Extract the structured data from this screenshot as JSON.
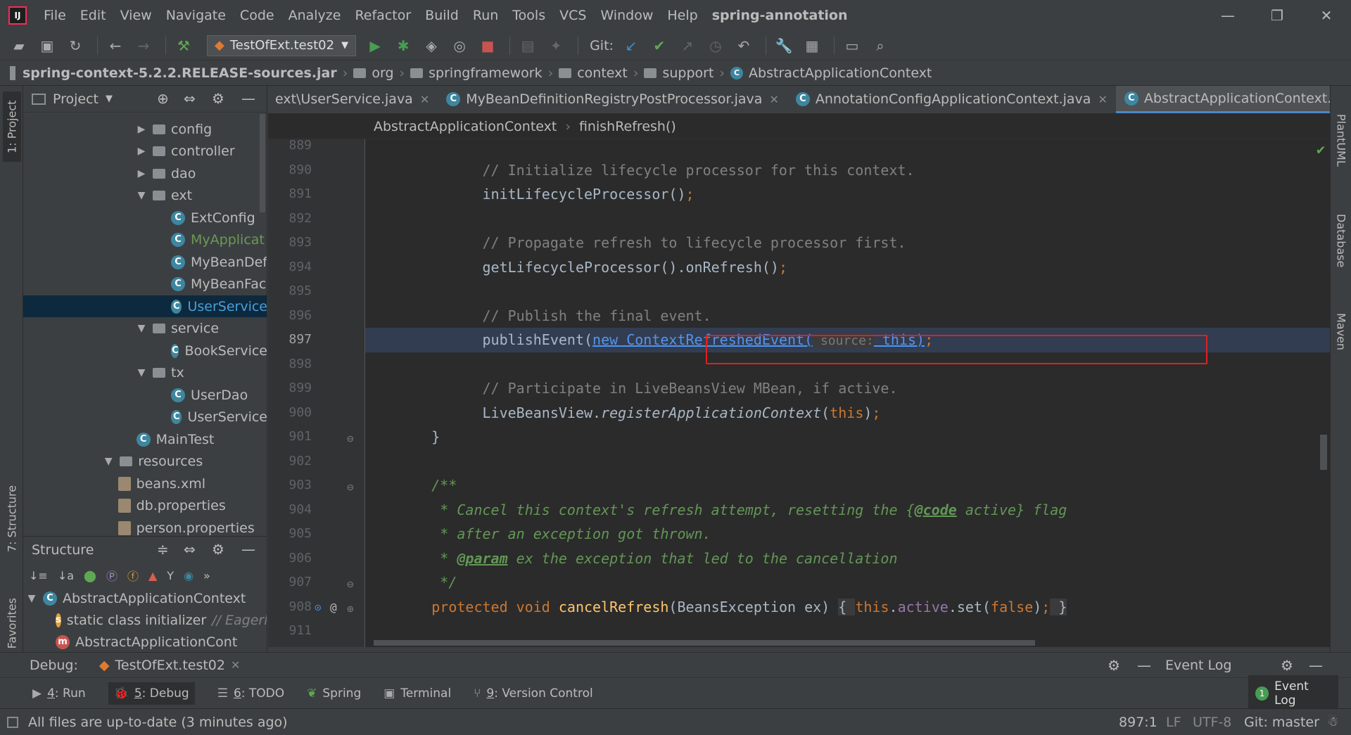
{
  "menu": {
    "items": [
      "File",
      "Edit",
      "View",
      "Navigate",
      "Code",
      "Analyze",
      "Refactor",
      "Build",
      "Run",
      "Tools",
      "VCS",
      "Window",
      "Help"
    ],
    "project_title": "spring-annotation"
  },
  "toolbar": {
    "run_config": "TestOfExt.test02",
    "git_label": "Git:"
  },
  "navbar": {
    "crumbs": [
      "spring-context-5.2.2.RELEASE-sources.jar",
      "org",
      "springframework",
      "context",
      "support",
      "AbstractApplicationContext"
    ]
  },
  "left_strip": {
    "project_tab": "1: Project",
    "structure_tab": "7: Structure",
    "favorites_tab": "2: Favorites"
  },
  "right_strip": {
    "plantuml": "PlantUML",
    "database": "Database",
    "maven": "Maven"
  },
  "project_panel": {
    "title": "Project",
    "tree": [
      {
        "label": "config",
        "type": "folder",
        "expanded": false
      },
      {
        "label": "controller",
        "type": "folder",
        "expanded": false
      },
      {
        "label": "dao",
        "type": "folder",
        "expanded": false
      },
      {
        "label": "ext",
        "type": "folder",
        "expanded": true
      },
      {
        "label": "ExtConfig",
        "type": "class"
      },
      {
        "label": "MyApplicat",
        "type": "class"
      },
      {
        "label": "MyBeanDef",
        "type": "class"
      },
      {
        "label": "MyBeanFac",
        "type": "class"
      },
      {
        "label": "UserService",
        "type": "class",
        "selected": true
      },
      {
        "label": "service",
        "type": "folder",
        "expanded": true
      },
      {
        "label": "BookService",
        "type": "class"
      },
      {
        "label": "tx",
        "type": "folder",
        "expanded": true
      },
      {
        "label": "UserDao",
        "type": "class"
      },
      {
        "label": "UserService",
        "type": "class"
      },
      {
        "label": "MainTest",
        "type": "class"
      },
      {
        "label": "resources",
        "type": "folder",
        "expanded": true
      },
      {
        "label": "beans.xml",
        "type": "file"
      },
      {
        "label": "db.properties",
        "type": "file"
      },
      {
        "label": "person.properties",
        "type": "file"
      }
    ]
  },
  "structure_panel": {
    "title": "Structure",
    "items": [
      {
        "label": "AbstractApplicationContext",
        "suffix": ""
      },
      {
        "label": "static class initializer",
        "suffix": "// Eagerly"
      },
      {
        "label": "AbstractApplicationCont",
        "suffix": ""
      }
    ]
  },
  "editor": {
    "tabs": [
      {
        "label": "ext\\UserService.java",
        "active": false
      },
      {
        "label": "MyBeanDefinitionRegistryPostProcessor.java",
        "active": false
      },
      {
        "label": "AnnotationConfigApplicationContext.java",
        "active": false
      },
      {
        "label": "AbstractApplicationContext.java",
        "active": true
      }
    ],
    "tab_overflow": "6",
    "breadcrumb": [
      "AbstractApplicationContext",
      "finishRefresh()"
    ],
    "current_line": 897,
    "lines": [
      {
        "n": "889"
      },
      {
        "n": "890",
        "comment": "// Initialize lifecycle processor for this context."
      },
      {
        "n": "891",
        "call": "initLifecycleProcessor",
        "rest": "();"
      },
      {
        "n": "892"
      },
      {
        "n": "893",
        "comment": "// Propagate refresh to lifecycle processor first."
      },
      {
        "n": "894",
        "call": "getLifecycleProcessor().onRefresh",
        "rest": "();"
      },
      {
        "n": "895"
      },
      {
        "n": "896",
        "comment": "// Publish the final event."
      },
      {
        "n": "897",
        "call": "publishEvent(",
        "new_kw": "new ",
        "type": "ContextRefreshedEvent(",
        "hint": " source:",
        "this_kw": " this",
        "end": ");"
      },
      {
        "n": "898"
      },
      {
        "n": "899",
        "comment": "// Participate in LiveBeansView MBean, if active."
      },
      {
        "n": "900",
        "cls": "LiveBeansView.",
        "method": "registerApplicationContext",
        "open": "(",
        "this_kw": "this",
        "end": ");"
      },
      {
        "n": "901",
        "brace": "}"
      },
      {
        "n": "902"
      },
      {
        "n": "903",
        "doc": "/**"
      },
      {
        "n": "904",
        "doc_pre": " * Cancel this context's refresh attempt, resetting the {",
        "doc_tag": "@code",
        "doc_post": " active} flag"
      },
      {
        "n": "905",
        "doc": " * after an exception got thrown."
      },
      {
        "n": "906",
        "doc_pre": " * ",
        "doc_tag": "@param",
        "doc_post": " ex the exception that led to the cancellation"
      },
      {
        "n": "907",
        "doc": " */"
      },
      {
        "n": "908",
        "kw1": "protected void ",
        "fn": "cancelRefresh",
        "args": "(BeansException ex) ",
        "body_open": "{ ",
        "this_kw": "this",
        "dot": ".",
        "fld": "active",
        "call2": ".set(",
        "false_kw": "false",
        "tail": "); ",
        "body_close": "}"
      },
      {
        "n": "911"
      }
    ]
  },
  "debug_bar": {
    "label": "Debug:",
    "session": "TestOfExt.test02",
    "event_log": "Event Log"
  },
  "tool_windows": [
    {
      "key": "4",
      "label": ": Run",
      "icon": "▶"
    },
    {
      "key": "5",
      "label": ": Debug",
      "icon": "🐞"
    },
    {
      "key": "6",
      "label": ": TODO",
      "icon": "☰"
    },
    {
      "key": "",
      "label": "Spring",
      "icon": "❦"
    },
    {
      "key": "",
      "label": "Terminal",
      "icon": "▣"
    },
    {
      "key": "9",
      "label": ": Version Control",
      "icon": "⑂"
    }
  ],
  "event_log_btn": {
    "badge": "1",
    "label": "Event Log"
  },
  "status": {
    "message": "All files are up-to-date (3 minutes ago)",
    "position": "897:1",
    "line_sep": "LF",
    "encoding": "UTF-8",
    "git": "Git: master"
  }
}
